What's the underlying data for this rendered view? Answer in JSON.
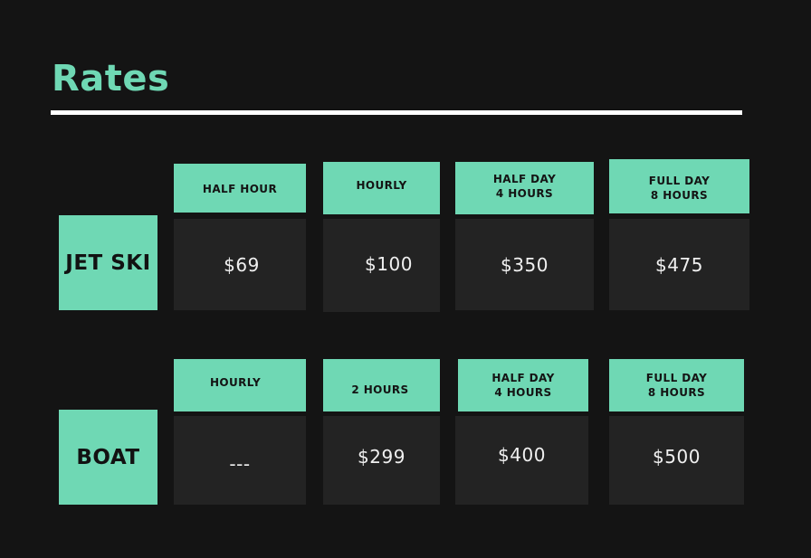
{
  "title": "Rates",
  "colors": {
    "background": "#141414",
    "accent": "#6fd8b4",
    "cell": "#232323",
    "rule": "#ffffff"
  },
  "jet_ski": {
    "label": "JET SKI",
    "headers": [
      {
        "line1": "HALF HOUR",
        "line2": ""
      },
      {
        "line1": "HOURLY",
        "line2": ""
      },
      {
        "line1": "HALF DAY",
        "line2": "4 HOURS"
      },
      {
        "line1": "FULL DAY",
        "line2": "8 HOURS"
      }
    ],
    "prices": [
      "$69",
      "$100",
      "$350",
      "$475"
    ]
  },
  "boat": {
    "label": "BOAT",
    "headers": [
      {
        "line1": "HOURLY",
        "line2": ""
      },
      {
        "line1": "2 HOURS",
        "line2": ""
      },
      {
        "line1": "HALF DAY",
        "line2": "4 HOURS"
      },
      {
        "line1": "FULL DAY",
        "line2": "8 HOURS"
      }
    ],
    "prices": [
      "---",
      "$299",
      "$400",
      "$500"
    ]
  }
}
